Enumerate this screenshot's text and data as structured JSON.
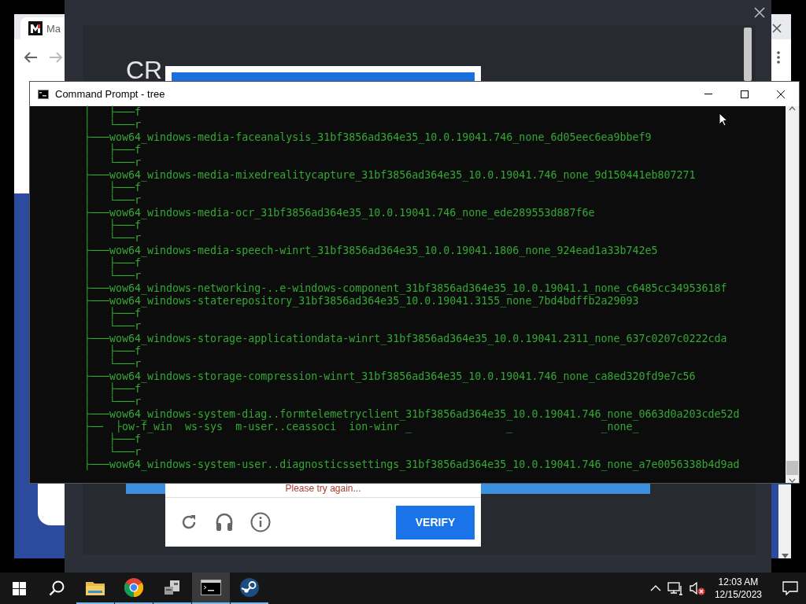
{
  "browser": {
    "tab_title": "Ma"
  },
  "overlay": {
    "heading": "CR"
  },
  "captcha": {
    "message": "Please try again...",
    "verify_button": "VERIFY"
  },
  "command_prompt": {
    "title": "Command Prompt - tree",
    "lines": [
      "│   ├───f",
      "│   └───r",
      "├───wow64_windows-media-faceanalysis_31bf3856ad364e35_10.0.19041.746_none_6d05eec6ea9bbef9",
      "│   ├───f",
      "│   └───r",
      "├───wow64_windows-media-mixedrealitycapture_31bf3856ad364e35_10.0.19041.746_none_9d150441eb807271",
      "│   ├───f",
      "│   └───r",
      "├───wow64_windows-media-ocr_31bf3856ad364e35_10.0.19041.746_none_ede289553d887f6e",
      "│   ├───f",
      "│   └───r",
      "├───wow64_windows-media-speech-winrt_31bf3856ad364e35_10.0.19041.1806_none_924ead1a33b742e5",
      "│   ├───f",
      "│   └───r",
      "├───wow64_windows-networking-..e-windows-component_31bf3856ad364e35_10.0.19041.1_none_c6485cc34953618f",
      "├───wow64_windows-staterepository_31bf3856ad364e35_10.0.19041.3155_none_7bd4bdffb2a29093",
      "│   ├───f",
      "│   └───r",
      "├───wow64_windows-storage-applicationdata-winrt_31bf3856ad364e35_10.0.19041.2311_none_637c0207c0222cda",
      "│   ├───f",
      "│   └───r",
      "├───wow64_windows-storage-compression-winrt_31bf3856ad364e35_10.0.19041.746_none_ca8ed320fd9e7c56",
      "│   ├───f",
      "│   └───r",
      "├───wow64_windows-system-diag..formtelemetryclient_31bf3856ad364e35_10.0.19041.746_none_0663d0a203cde52d",
      "├──  ├ow-f_win  ws-sys  m-user..ceassoci  ion-winr _               _              _none_",
      "│   ├───f",
      "│   └───r",
      "├───wow64_windows-system-user..diagnosticssettings_31bf3856ad364e35_10.0.19041.746_none_a7e0056338b4d9ad"
    ]
  },
  "taskbar": {
    "apps": [
      {
        "kind": "folder",
        "running": true,
        "selected": false
      },
      {
        "kind": "browser",
        "running": true,
        "selected": false
      },
      {
        "kind": "package",
        "running": true,
        "selected": false
      },
      {
        "kind": "terminal",
        "running": true,
        "selected": true
      },
      {
        "kind": "round-logo",
        "running": true,
        "selected": false
      }
    ],
    "clock": {
      "time": "12:03 AM",
      "date": "12/15/2023"
    }
  }
}
